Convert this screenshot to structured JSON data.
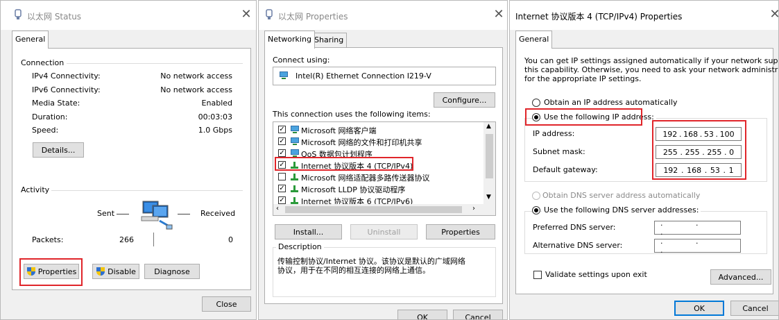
{
  "status_window": {
    "title": "以太网 Status",
    "tab": "General",
    "connection": {
      "header": "Connection",
      "rows": [
        {
          "label": "IPv4 Connectivity:",
          "value": "No network access"
        },
        {
          "label": "IPv6 Connectivity:",
          "value": "No network access"
        },
        {
          "label": "Media State:",
          "value": "Enabled"
        },
        {
          "label": "Duration:",
          "value": "00:03:03"
        },
        {
          "label": "Speed:",
          "value": "1.0 Gbps"
        }
      ],
      "details_button": "Details..."
    },
    "activity": {
      "header": "Activity",
      "sent": "Sent",
      "received": "Received",
      "packets_label": "Packets:",
      "packets_sent": "266",
      "packets_received": "0"
    },
    "buttons": {
      "properties": "Properties",
      "disable": "Disable",
      "diagnose": "Diagnose",
      "close": "Close"
    }
  },
  "properties_window": {
    "title": "以太网 Properties",
    "tabs": [
      "Networking",
      "Sharing"
    ],
    "connect_using_label": "Connect using:",
    "adapter": "Intel(R) Ethernet Connection I219-V",
    "configure_button": "Configure...",
    "items_label": "This connection uses the following items:",
    "items": [
      {
        "label": "Microsoft 网络客户端",
        "checked": true,
        "icon": "network-client-icon"
      },
      {
        "label": "Microsoft 网络的文件和打印机共享",
        "checked": true,
        "icon": "network-client-icon"
      },
      {
        "label": "QoS 数据包计划程序",
        "checked": true,
        "icon": "network-client-icon"
      },
      {
        "label": "Internet 协议版本 4 (TCP/IPv4)",
        "checked": true,
        "icon": "protocol-icon"
      },
      {
        "label": "Microsoft 网络适配器多路传送器协议",
        "checked": false,
        "icon": "protocol-icon"
      },
      {
        "label": "Microsoft LLDP 协议驱动程序",
        "checked": true,
        "icon": "protocol-icon"
      },
      {
        "label": "Internet 协议版本 6 (TCP/IPv6)",
        "checked": true,
        "icon": "protocol-icon"
      }
    ],
    "buttons": {
      "install": "Install...",
      "uninstall": "Uninstall",
      "properties": "Properties",
      "ok": "OK",
      "cancel": "Cancel"
    },
    "description_label": "Description",
    "description_text_1": "传输控制协议/Internet 协议。该协议是默认的广域网络",
    "description_text_2": "协议，用于在不同的相互连接的网络上通信。"
  },
  "ipv4_window": {
    "title": "Internet 协议版本 4 (TCP/IPv4) Properties",
    "tab": "General",
    "intro_1": "You can get IP settings assigned automatically if your network supports",
    "intro_2": "this capability. Otherwise, you need to ask your network administrator",
    "intro_3": "for the appropriate IP settings.",
    "obtain_ip_auto": "Obtain an IP address automatically",
    "use_following_ip": "Use the following IP address:",
    "ip_label": "IP address:",
    "ip_octets": [
      "192",
      "168",
      "53",
      "100"
    ],
    "subnet_label": "Subnet mask:",
    "subnet_octets": [
      "255",
      "255",
      "255",
      "0"
    ],
    "gateway_label": "Default gateway:",
    "gateway_octets": [
      "192",
      "168",
      "53",
      "1"
    ],
    "obtain_dns_auto": "Obtain DNS server address automatically",
    "use_following_dns": "Use the following DNS server addresses:",
    "preferred_dns_label": "Preferred DNS server:",
    "alternate_dns_label": "Alternative DNS server:",
    "empty_ip": ". . .",
    "validate_label": "Validate settings upon exit",
    "advanced_button": "Advanced...",
    "buttons": {
      "ok": "OK",
      "cancel": "Cancel"
    }
  },
  "colors": {
    "highlight": "#e0252a",
    "accent": "#0078d7"
  }
}
